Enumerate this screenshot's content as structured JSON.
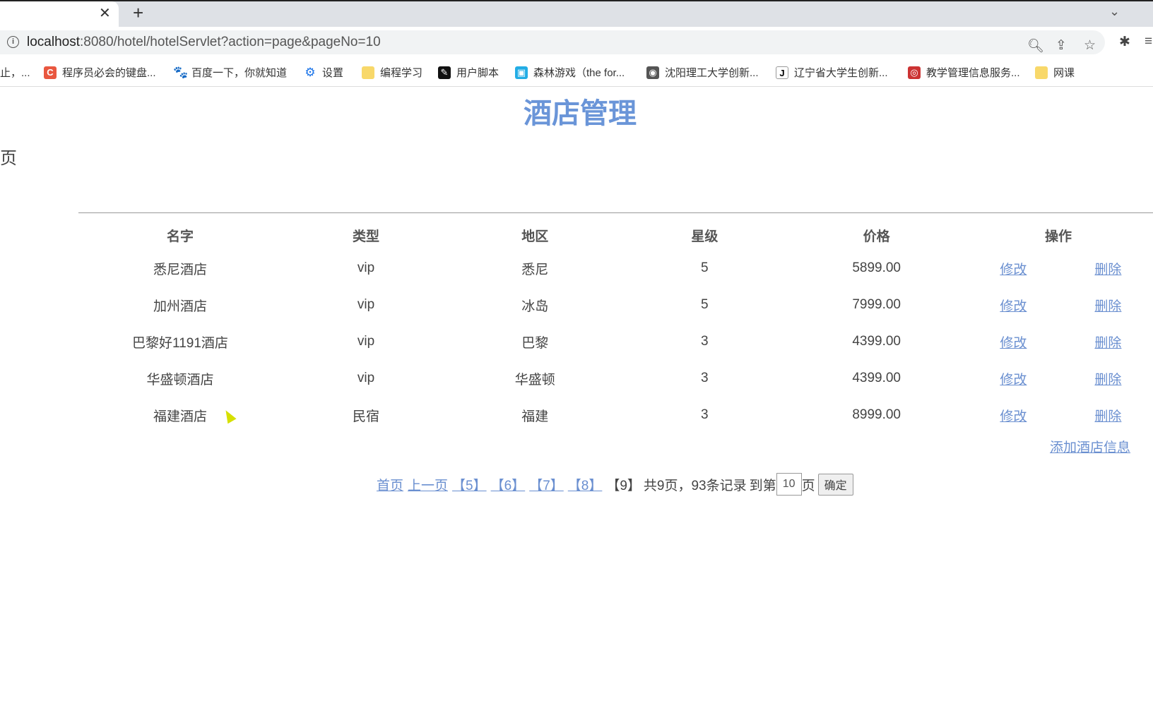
{
  "browser": {
    "tab_close": "✕",
    "new_tab": "+",
    "chevron": "⌄",
    "url_host": "localhost",
    "url_rest": ":8080/hotel/hotelServlet?action=page&pageNo=10",
    "bookmarks": [
      {
        "label": "止，...",
        "icon": "none"
      },
      {
        "label": "程序员必会的键盘...",
        "icon": "csdn-icon",
        "color": "#e9573f",
        "glyph": "C"
      },
      {
        "label": "百度一下，你就知道",
        "icon": "baidu-paw-icon",
        "color": "#2932e1",
        "glyph": "🐾"
      },
      {
        "label": "设置",
        "icon": "gear-icon",
        "color": "#1a73e8",
        "glyph": "⚙"
      },
      {
        "label": "编程学习",
        "icon": "folder-icon",
        "color": "#f8d86a",
        "glyph": ""
      },
      {
        "label": "用户脚本",
        "icon": "tampermonkey-icon",
        "color": "#111",
        "glyph": "✎"
      },
      {
        "label": "森林游戏（the for...",
        "icon": "bilibili-icon",
        "color": "#23ade5",
        "glyph": "▣"
      },
      {
        "label": "沈阳理工大学创新...",
        "icon": "globe-icon",
        "color": "#555",
        "glyph": "◉"
      },
      {
        "label": "辽宁省大学生创新...",
        "icon": "j-icon",
        "color": "#fff",
        "glyph": "J"
      },
      {
        "label": "教学管理信息服务...",
        "icon": "school-icon",
        "color": "#c33",
        "glyph": "◎"
      },
      {
        "label": "网课",
        "icon": "folder-icon",
        "color": "#f8d86a",
        "glyph": ""
      }
    ]
  },
  "page": {
    "title": "酒店管理",
    "fragment": "页",
    "headers": [
      "名字",
      "类型",
      "地区",
      "星级",
      "价格",
      "操作"
    ],
    "rows": [
      {
        "name": "悉尼酒店",
        "type": "vip",
        "region": "悉尼",
        "stars": "5",
        "price": "5899.00"
      },
      {
        "name": "加州酒店",
        "type": "vip",
        "region": "冰岛",
        "stars": "5",
        "price": "7999.00"
      },
      {
        "name": "巴黎好1191酒店",
        "type": "vip",
        "region": "巴黎",
        "stars": "3",
        "price": "4399.00"
      },
      {
        "name": "华盛顿酒店",
        "type": "vip",
        "region": "华盛顿",
        "stars": "3",
        "price": "4399.00"
      },
      {
        "name": "福建酒店",
        "type": "民宿",
        "region": "福建",
        "stars": "3",
        "price": "8999.00"
      }
    ],
    "edit_label": "修改",
    "delete_label": "删除",
    "add_label": "添加酒店信息",
    "pager": {
      "first": "首页",
      "prev": "上一页",
      "pages": [
        "【5】",
        "【6】",
        "【7】",
        "【8】"
      ],
      "current": "【9】",
      "summary": "共9页，93条记录",
      "goto_prefix": "到第",
      "goto_value": "10",
      "goto_suffix": "页",
      "confirm": "确定"
    }
  }
}
